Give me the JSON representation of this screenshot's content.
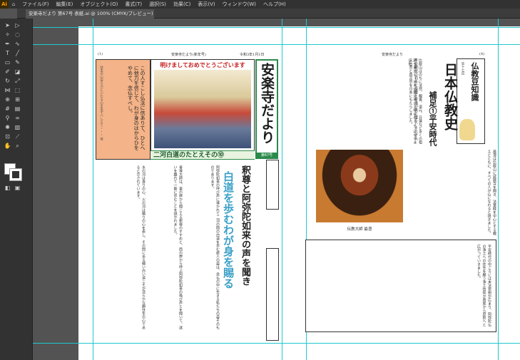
{
  "app": {
    "logo": "Ai"
  },
  "menu": {
    "items": [
      "ファイル(F)",
      "編集(E)",
      "オブジェクト(O)",
      "書式(T)",
      "選択(S)",
      "効果(C)",
      "表示(V)",
      "ウィンドウ(W)",
      "ヘルプ(H)"
    ]
  },
  "tab": {
    "title": "安楽寺だより 第67号 表紙.ai @ 100% (CMYK/プレビュー)"
  },
  "left_page": {
    "header_left": "(1)",
    "header_center": "安楽寺だより(新年号)",
    "header_right": "令和3年1月1日",
    "pink_box_text": "この人すこし仏法に信ありて、ひとへに他力を信じて、わが身のはからひをやめて、念仏すべし。",
    "pink_box_note": "往生の心安らかにいたる心を生ずべしとて・・・ 覚",
    "new_year_title": "明けましておめでとうございます",
    "masthead": "安楽寺だより",
    "issue": "第67号",
    "section_banner": "二河白道のたとえその⑩",
    "headline_1": "釈尊と阿弥陀如来の声を聞き",
    "headline_2": "白道を歩むわが身を賜る",
    "body_text_1": "阿弥陀如来の呼び声に導かれて二河の間の白道を歩む旅人の姿は、念仏の中に生きる私たちの姿そのものであります。",
    "body_text_2": "善導大師は、東の岸から聞こえる釈尊のすすめと、西の岸から呼ぶ阿弥陀如来の喚び声とを聞いて、迷いを離れて一筋に歩むことを説かれました。",
    "body_text_3": "水の河は貪りの心、火の河は瞋りの心を表し、その間にある細い白い道こそが清らかな願往生の心であると示されています。"
  },
  "right_page": {
    "header_center": "安楽寺だより",
    "header_right": "(4)",
    "column_title": "仏教豆知識",
    "column_sub": "第十七回",
    "history_title": "日本仏教史",
    "history_sub": "補足①平安時代",
    "portrait_caption": "伝教大師 最澄",
    "body_text_1": "平安時代の初めに最澄と空海が唐に渡り、それぞれ天台宗と真言宗を日本にもたらしました。",
    "body_text_2": "最澄は比叡山に延暦寺を開き、法華経を中心とする教えとともに、すべての人が仏になれると説きました。",
    "body_text_3": "比叡山はのちに法然、親鸞、道元、日蓮など多くの祖師を輩出し、日本仏教の母山と呼ばれるようになりました。",
    "bottom_text": "平安時代の中ごろには末法思想が広まり、阿弥陀仏の浄土への往生を願う浄土信仰が貴族から庶民へと広がっていきました。"
  }
}
